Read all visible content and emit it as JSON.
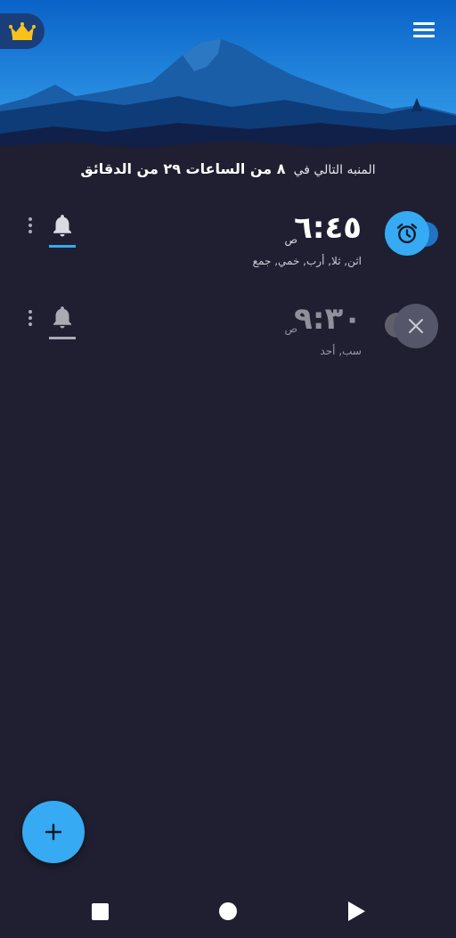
{
  "header": {
    "premium_icon": "crown-icon",
    "menu_icon": "hamburger-menu-icon",
    "sky_top": "#0a63c8",
    "sky_bottom": "#3aa6ef"
  },
  "next_alarm": {
    "prefix": "المنبه التالي في",
    "text": "٨ من الساعات ٢٩ من الدقائق"
  },
  "alarms": [
    {
      "time": "٦:٤٥",
      "ampm": "ص",
      "days": "اثن, ثلا, أرب, خمي, جمع",
      "enabled": true,
      "icon": "alarm-clock-icon"
    },
    {
      "time": "٩:٣٠",
      "ampm": "ص",
      "days": "سب, أحد",
      "enabled": false,
      "icon": "close-icon"
    }
  ],
  "colors": {
    "accent": "#36aaf2",
    "background": "#1f1f31",
    "disabled": "#5f5f6c"
  },
  "fab_icon": "plus-icon",
  "nav": {
    "recents_icon": "square-icon",
    "home_icon": "circle-icon",
    "back_icon": "triangle-icon"
  }
}
